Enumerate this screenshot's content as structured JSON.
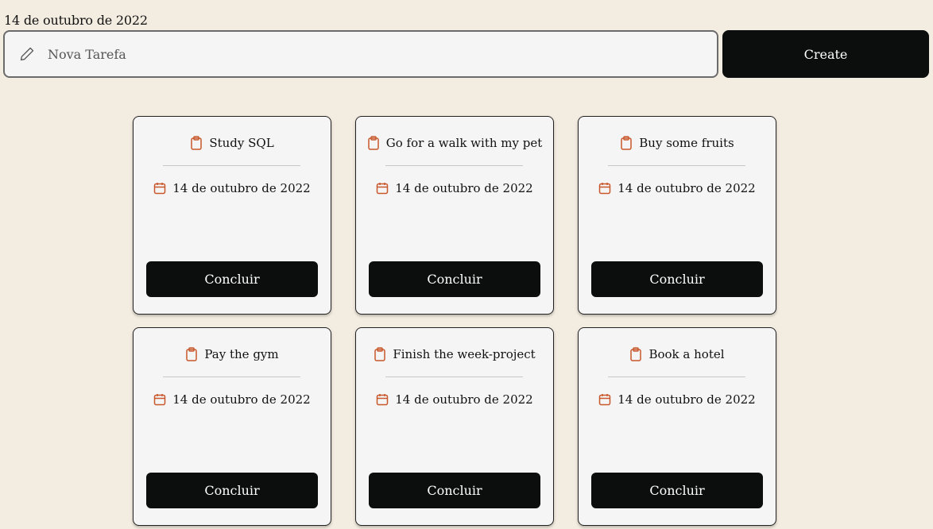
{
  "header": {
    "date": "14 de outubro de 2022"
  },
  "new_task": {
    "placeholder": "Nova Tarefa",
    "value": "",
    "create_label": "Create",
    "icon": "pencil-icon"
  },
  "colors": {
    "background": "#f3ece0",
    "card_background": "#f5f5f5",
    "button": "#0c0d0d",
    "icon_accent": "#c8582c"
  },
  "tasks": [
    {
      "title": "Study SQL",
      "date": "14 de outubro de 2022",
      "action_label": "Concluir"
    },
    {
      "title": "Go for a walk with my pet",
      "date": "14 de outubro de 2022",
      "action_label": "Concluir"
    },
    {
      "title": "Buy some fruits",
      "date": "14 de outubro de 2022",
      "action_label": "Concluir"
    },
    {
      "title": "Pay the gym",
      "date": "14 de outubro de 2022",
      "action_label": "Concluir"
    },
    {
      "title": "Finish the week-project",
      "date": "14 de outubro de 2022",
      "action_label": "Concluir"
    },
    {
      "title": "Book a hotel",
      "date": "14 de outubro de 2022",
      "action_label": "Concluir"
    }
  ]
}
